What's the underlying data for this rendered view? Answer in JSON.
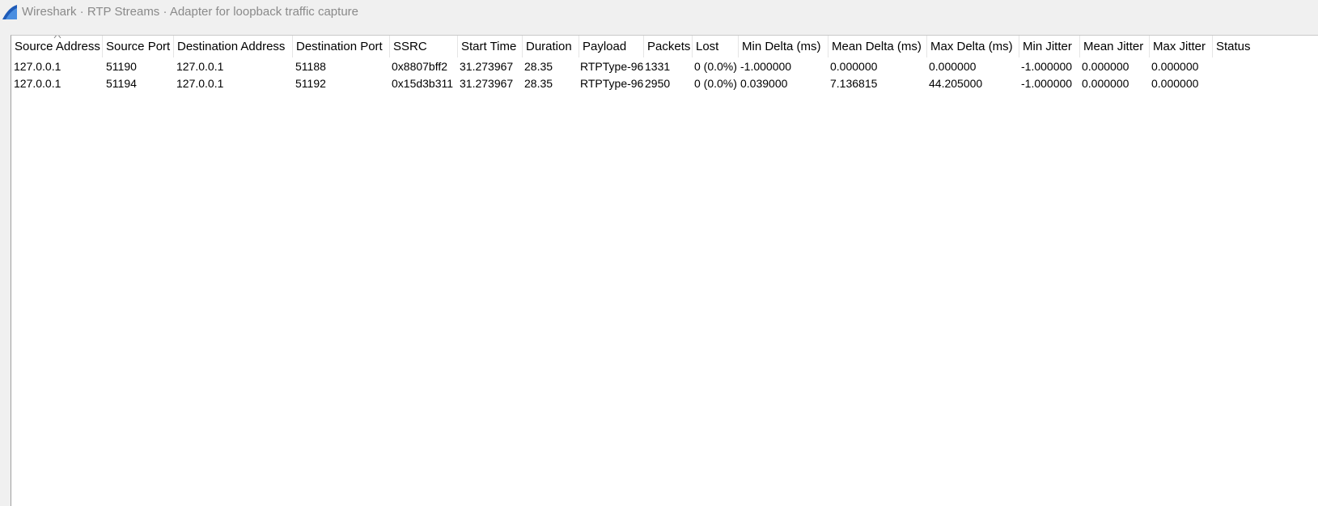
{
  "window": {
    "title": "Wireshark · RTP Streams · Adapter for loopback traffic capture",
    "app_icon": "wireshark-fin-icon"
  },
  "table": {
    "sorted_column": "Source Address",
    "sort_direction": "ascending",
    "columns": [
      "Source Address",
      "Source Port",
      "Destination Address",
      "Destination Port",
      "SSRC",
      "Start Time",
      "Duration",
      "Payload",
      "Packets",
      "Lost",
      "Min Delta (ms)",
      "Mean Delta (ms)",
      "Max Delta (ms)",
      "Min Jitter",
      "Mean Jitter",
      "Max Jitter",
      "Status"
    ],
    "rows": [
      [
        "127.0.0.1",
        "51190",
        "127.0.0.1",
        "51188",
        "0x8807bff2",
        "31.273967",
        "28.35",
        "RTPType-96",
        "1331",
        "0 (0.0%)",
        "-1.000000",
        "0.000000",
        "0.000000",
        "-1.000000",
        "0.000000",
        "0.000000",
        ""
      ],
      [
        "127.0.0.1",
        "51194",
        "127.0.0.1",
        "51192",
        "0x15d3b311",
        "31.273967",
        "28.35",
        "RTPType-96",
        "2950",
        "0 (0.0%)",
        "0.039000",
        "7.136815",
        "44.205000",
        "-1.000000",
        "0.000000",
        "0.000000",
        ""
      ]
    ]
  },
  "colors": {
    "window_bg": "#f0f0f0",
    "table_bg": "#ffffff",
    "title_text": "#8a8a8a",
    "icon_blue": "#1e5bb8"
  }
}
